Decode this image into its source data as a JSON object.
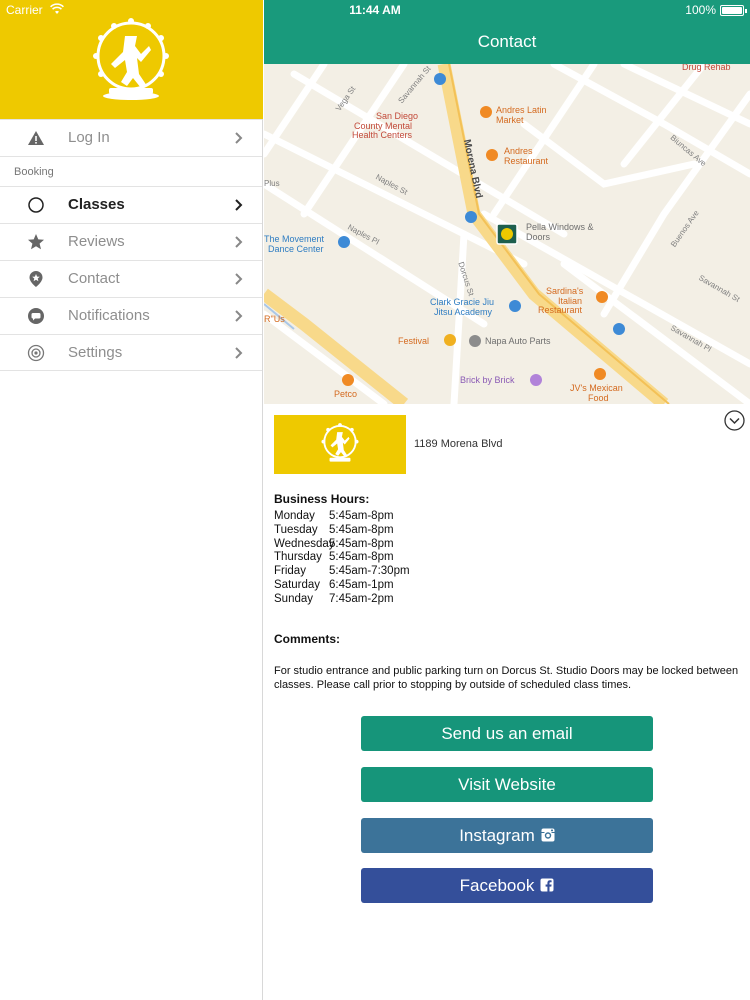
{
  "status_bar": {
    "carrier": "Carrier",
    "time": "11:44 AM",
    "battery": "100%"
  },
  "sidebar": {
    "items": [
      {
        "label": "Log In",
        "icon": "warning-icon"
      }
    ],
    "section_label": "Booking",
    "booking_items": [
      {
        "label": "Classes",
        "icon": "circle-icon",
        "active": true
      },
      {
        "label": "Reviews",
        "icon": "star-icon"
      },
      {
        "label": "Contact",
        "icon": "location-pin-icon"
      },
      {
        "label": "Notifications",
        "icon": "chat-bubble-icon"
      },
      {
        "label": "Settings",
        "icon": "gear-icon"
      }
    ]
  },
  "header": {
    "title": "Contact"
  },
  "map": {
    "labels": [
      "Drug Rehab",
      "San Diego",
      "County Mental",
      "Health Centers",
      "Andres Latin",
      "Market",
      "Andres",
      "Restaurant",
      "Pella Windows &",
      "Doors",
      "The Movement",
      "Dance Center",
      "Sardina's",
      "Italian",
      "Restaurant",
      "Clark Gracie Jiu",
      "Jitsu Academy",
      "Festival",
      "Napa Auto Parts",
      "Brick by Brick",
      "JV's Mexican",
      "Food",
      "Petco",
      "R\"Us"
    ],
    "streets": [
      "Vega St",
      "Savannah St",
      "Morena Blvd",
      "Naples St",
      "Naples Pl",
      "Dorcus St",
      "Plus",
      "Biuncas Ave",
      "Buenos Ave",
      "Savannah St",
      "Savannah Pl"
    ]
  },
  "contact": {
    "address": "1189 Morena Blvd",
    "hours_title": "Business Hours:",
    "hours": [
      {
        "day": "Monday",
        "time": "5:45am-8pm"
      },
      {
        "day": "Tuesday",
        "time": "5:45am-8pm"
      },
      {
        "day": "Wednesday",
        "time": "5:45am-8pm"
      },
      {
        "day": "Thursday",
        "time": "5:45am-8pm"
      },
      {
        "day": "Friday",
        "time": "5:45am-7:30pm"
      },
      {
        "day": "Saturday",
        "time": "6:45am-1pm"
      },
      {
        "day": "Sunday",
        "time": "7:45am-2pm"
      }
    ],
    "comments_title": "Comments:",
    "comments": "For studio entrance and public parking turn on Dorcus St. Studio Doors may be locked between classes. Please call prior to stopping by outside of scheduled class times."
  },
  "buttons": {
    "email": "Send us an email",
    "website": "Visit Website",
    "instagram": "Instagram",
    "facebook": "Facebook"
  },
  "colors": {
    "brand_yellow": "#eec900",
    "navbar_green": "#199a7c",
    "button_green": "#16957a",
    "instagram_blue": "#3c7399",
    "facebook_blue": "#344f9a"
  }
}
